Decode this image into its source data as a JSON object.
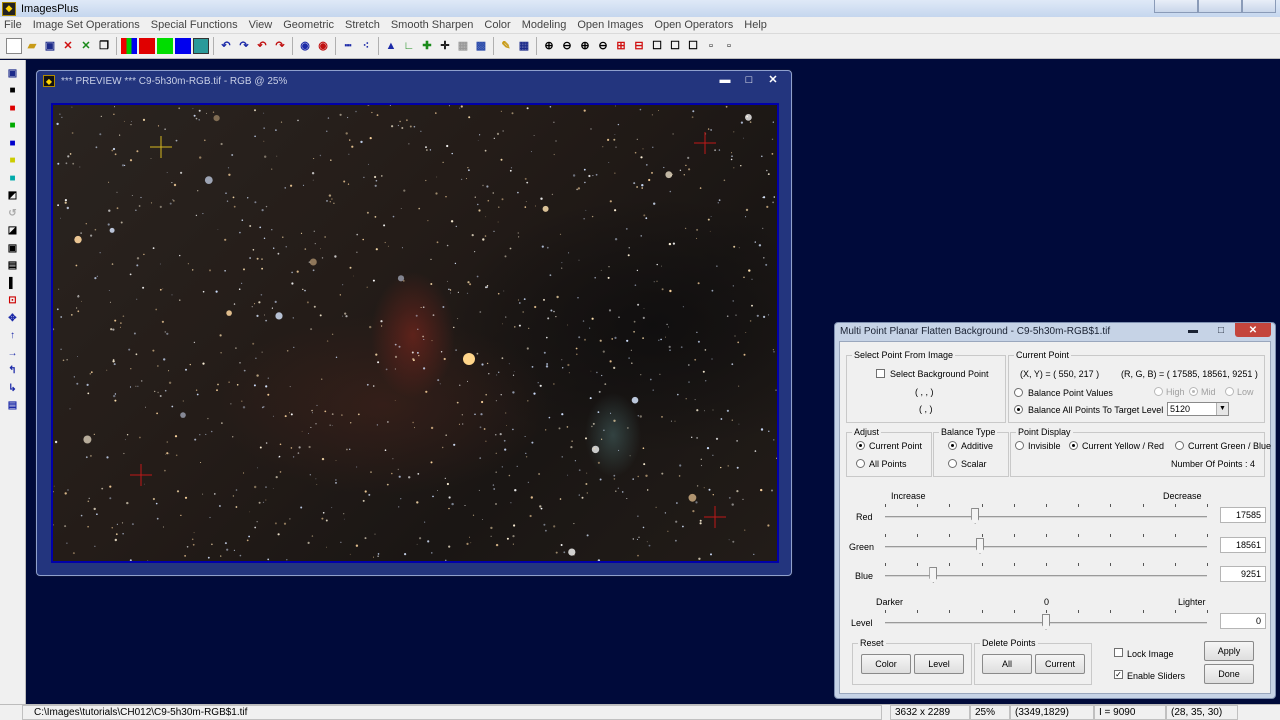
{
  "app": {
    "title": "ImagesPlus",
    "icon": "imagesplus-icon"
  },
  "menu": [
    "File",
    "Image Set Operations",
    "Special Functions",
    "View",
    "Geometric",
    "Stretch",
    "Smooth Sharpen",
    "Color",
    "Modeling",
    "Open Images",
    "Open Operators",
    "Help"
  ],
  "preview": {
    "title": "*** PREVIEW *** C9-5h30m-RGB.tif - RGB @ 25%",
    "min_glyph": "▬",
    "max_glyph": "□",
    "close_glyph": "✕"
  },
  "dialog": {
    "title": "Multi Point Planar Flatten Background - C9-5h30m-RGB$1.tif",
    "select_point": {
      "group_label": "Select Point From Image",
      "checkbox_label": "Select Background Point",
      "checked": false,
      "coord_line1": "( , , )",
      "coord_line2": "( , )"
    },
    "current_point": {
      "group_label": "Current Point",
      "xy": "(X, Y) = ( 550, 217 )",
      "rgb": "(R, G, B) = ( 17585, 18561, 9251 )",
      "balance_point_values": "Balance Point Values",
      "high": "High",
      "mid": "Mid",
      "low": "Low",
      "balance_all": "Balance All Points To Target Level",
      "target_level": "5120"
    },
    "adjust": {
      "group_label": "Adjust",
      "current_point": "Current Point",
      "all_points": "All Points"
    },
    "balance_type": {
      "group_label": "Balance Type",
      "additive": "Additive",
      "scalar": "Scalar"
    },
    "point_display": {
      "group_label": "Point Display",
      "invisible": "Invisible",
      "current_yellow_red": "Current Yellow / Red",
      "current_green_blue": "Current Green / Blue",
      "number_of_points": "Number Of Points : 4"
    },
    "sliders": {
      "increase": "Increase",
      "decrease": "Decrease",
      "red_label": "Red",
      "red_value": "17585",
      "red_pos": 0.28,
      "green_label": "Green",
      "green_value": "18561",
      "green_pos": 0.295,
      "blue_label": "Blue",
      "blue_value": "9251",
      "blue_pos": 0.15,
      "darker": "Darker",
      "zero": "0",
      "lighter": "Lighter",
      "level_label": "Level",
      "level_value": "0",
      "level_pos": 0.5
    },
    "reset": {
      "group_label": "Reset",
      "color": "Color",
      "level": "Level"
    },
    "delete_points": {
      "group_label": "Delete Points",
      "all": "All",
      "current": "Current"
    },
    "lock_image": "Lock Image",
    "enable_sliders": "Enable Sliders",
    "lock_checked": false,
    "enable_checked": true,
    "apply": "Apply",
    "done": "Done"
  },
  "status": {
    "path": "C:\\Images\\tutorials\\CH012\\C9-5h30m-RGB$1.tif",
    "dimensions": "3632 x 2289",
    "zoom": "25%",
    "coords": "(3349,1829)",
    "intensity": "I = 9090",
    "rgb": "(28, 35, 30)"
  }
}
